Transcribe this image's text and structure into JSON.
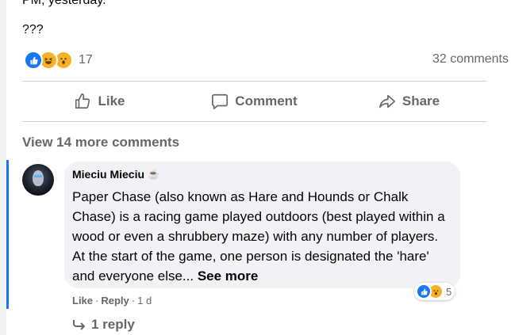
{
  "post": {
    "text_line_1": "PM, yesterday.",
    "text_line_2": "???"
  },
  "reactions": {
    "count": "17",
    "icons": [
      "like-icon",
      "haha-icon",
      "wow-icon"
    ],
    "comments_count": "32 comments"
  },
  "actions": {
    "like": "Like",
    "comment": "Comment",
    "share": "Share"
  },
  "view_more": "View 14 more comments",
  "comment": {
    "author": "Mieciu Mieciu",
    "badge": "☕",
    "text": "Paper Chase (also known as Hare and Hounds or Chalk Chase) is a racing game played outdoors (best played within a wood or even a shrubbery maze) with any number of players. At the start of the game, one person is designated the 'hare' and everyone else... ",
    "see_more": "See more",
    "like": "Like",
    "reply": "Reply",
    "time": "1 d",
    "reaction_count": "5",
    "replies": "1 reply"
  },
  "colors": {
    "accent": "#1877f2",
    "secondary_text": "#65676b",
    "bubble": "#f0f2f5"
  }
}
